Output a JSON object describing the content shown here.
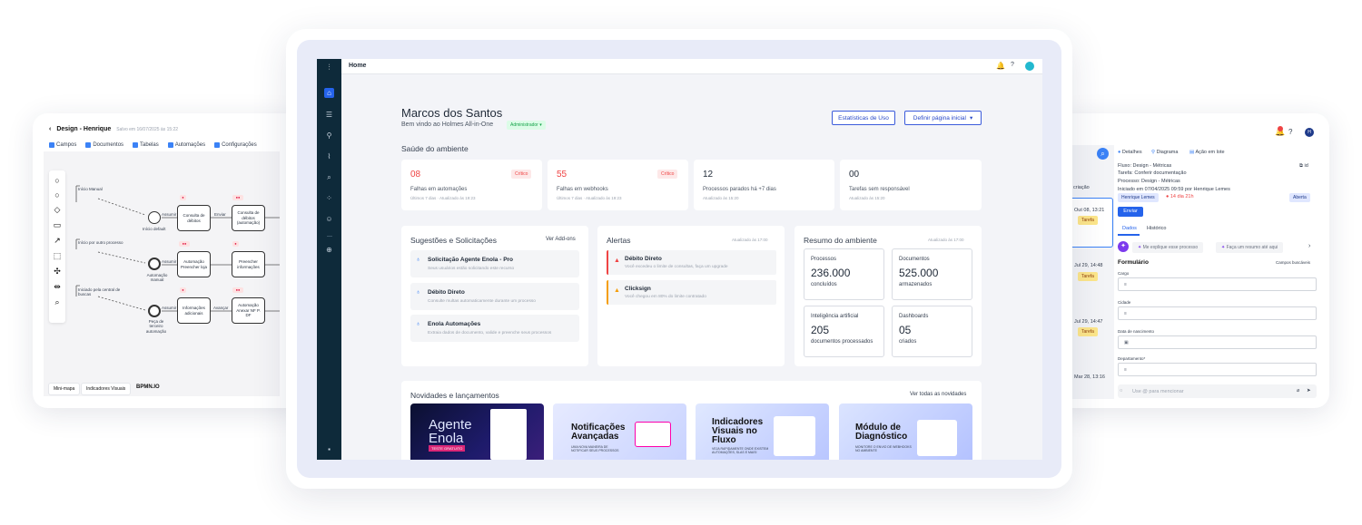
{
  "left_window": {
    "title": "Design - Henrique",
    "saved": "Salvo em 16/07/2025 às 15:22",
    "tabs": [
      "Campos",
      "Documentos",
      "Tabelas",
      "Automações",
      "Configurações"
    ],
    "lanes": [
      "Início Manual",
      "Início por outro processo",
      "Iniciado pela central de buscas"
    ],
    "events": [
      "Início default",
      "Automação manual",
      "Peça de terceiro automação"
    ],
    "tasks": [
      "Consulta de débitos",
      "Consulta de débitos (automação)",
      "Automação Preencher loja",
      "Preencher informações",
      "Informações adicionais",
      "Automação Anexar NF P. DF"
    ],
    "flows": [
      "Assumir",
      "Enviar",
      "Assumir",
      "Assumir",
      "Avançar"
    ],
    "bottom_buttons": [
      "Mini-mapa",
      "Indicadores Visuais"
    ],
    "logo": "BPMN.IO"
  },
  "main": {
    "topbar": {
      "title": "Home"
    },
    "header": {
      "name": "Marcos dos Santos",
      "welcome": "Bem vindo ao Holmes All-in-One",
      "role": "Administrador",
      "stats_button": "Estatísticas de Uso",
      "homepage_button": "Definir página inicial"
    },
    "health": {
      "title": "Saúde do ambiente",
      "cards": [
        {
          "value": "08",
          "label": "Falhas em automações",
          "meta": "Últimos 7 dias · Atualizado às 19:23",
          "badge": "Crítico",
          "critical": true
        },
        {
          "value": "55",
          "label": "Falhas em webhooks",
          "meta": "Últimos 7 dias · Atualizado às 19:23",
          "badge": "Crítico",
          "critical": true
        },
        {
          "value": "12",
          "label": "Processos parados há +7 dias",
          "meta": "Atualizado às 15:20",
          "badge": "",
          "critical": false
        },
        {
          "value": "00",
          "label": "Tarefas sem responsável",
          "meta": "Atualizado às 15:20",
          "badge": "",
          "critical": false
        }
      ]
    },
    "suggestions": {
      "title": "Sugestões e Solicitações",
      "link": "Ver Add-ons",
      "items": [
        {
          "title": "Solicitação Agente Enola - Pro",
          "desc": "Seus usuários estão solicitando este recurso"
        },
        {
          "title": "Débito Direto",
          "desc": "Consulte multas automaticamente durante um processo"
        },
        {
          "title": "Enola Automações",
          "desc": "Extraia dados de documento, valide e preenche seus processos"
        }
      ]
    },
    "alerts": {
      "title": "Alertas",
      "updated": "Atualizado às 17:00",
      "items": [
        {
          "title": "Débito Direto",
          "desc": "Você excedeu o limite de consultas, faça um upgrade",
          "color": "#ef4444"
        },
        {
          "title": "Clicksign",
          "desc": "Você chegou em 80% do limite contratado",
          "color": "#f59e0b"
        }
      ]
    },
    "summary": {
      "title": "Resumo do ambiente",
      "updated": "Atualizado às 17:00",
      "boxes": [
        {
          "label": "Processos",
          "value": "236.000",
          "sub": "concluídos"
        },
        {
          "label": "Documentos",
          "value": "525.000",
          "sub": "armazenados"
        },
        {
          "label": "Inteligência artificial",
          "value": "205",
          "sub": "documentos processados"
        },
        {
          "label": "Dashboards",
          "value": "05",
          "sub": "criados"
        }
      ]
    },
    "news": {
      "title": "Novidades e lançamentos",
      "link": "Ver todas as novidades",
      "items": [
        {
          "title": "Agente Enola",
          "tag": "TESTE GRATUITO"
        },
        {
          "title": "Notificações Avançadas",
          "sub": "UMA NOVA MANEIRA DE NOTIFICAR SEUS PROCESSOS"
        },
        {
          "title": "Indicadores Visuais no Fluxo",
          "sub": "VEJA RAPIDAMENTE ONDE EXISTEM AUTOMAÇÕES, SLAS E MAIS!"
        },
        {
          "title": "Módulo de Diagnóstico",
          "sub": "MONITORE O ENVIO DE WEBHOOKS NO AMBIENTE"
        }
      ]
    }
  },
  "right_window": {
    "tabs": [
      "Detalhes",
      "Diagrama",
      "Ação em lote"
    ],
    "flow": "Fluxo: Design - Métricas",
    "task": "Tarefa: Conferir documentação",
    "process": "Processo: Design - Métricas",
    "started": "Iniciado em 07/04/2025 09:59 por Henrique Lemes",
    "assignee": "Henrique Lemes",
    "late": "14 dia 21h",
    "status": "Aberta",
    "send": "Enviar",
    "subtabs": [
      "Dados",
      "Histórico"
    ],
    "prompts": [
      "Me explique esse processo",
      "Faça um resumo até aqui"
    ],
    "form_title": "Formulário",
    "form_link": "Campos buscáveis",
    "fields": [
      "Cargo",
      "Cidade",
      "Data de nascimento",
      "Departamento*"
    ],
    "comment_placeholder": "Use @ para mencionar",
    "list": [
      {
        "date": "Out 08, 13:21",
        "tag": "Tarefa"
      },
      {
        "date": "Jul 29, 14:48",
        "tag": "Tarefa"
      },
      {
        "date": "Jul 29, 14:47",
        "tag": "Tarefa"
      },
      {
        "date": "Mar 28, 13:16",
        "tag": ""
      }
    ],
    "sort_label": "criação",
    "id_label": "id"
  }
}
